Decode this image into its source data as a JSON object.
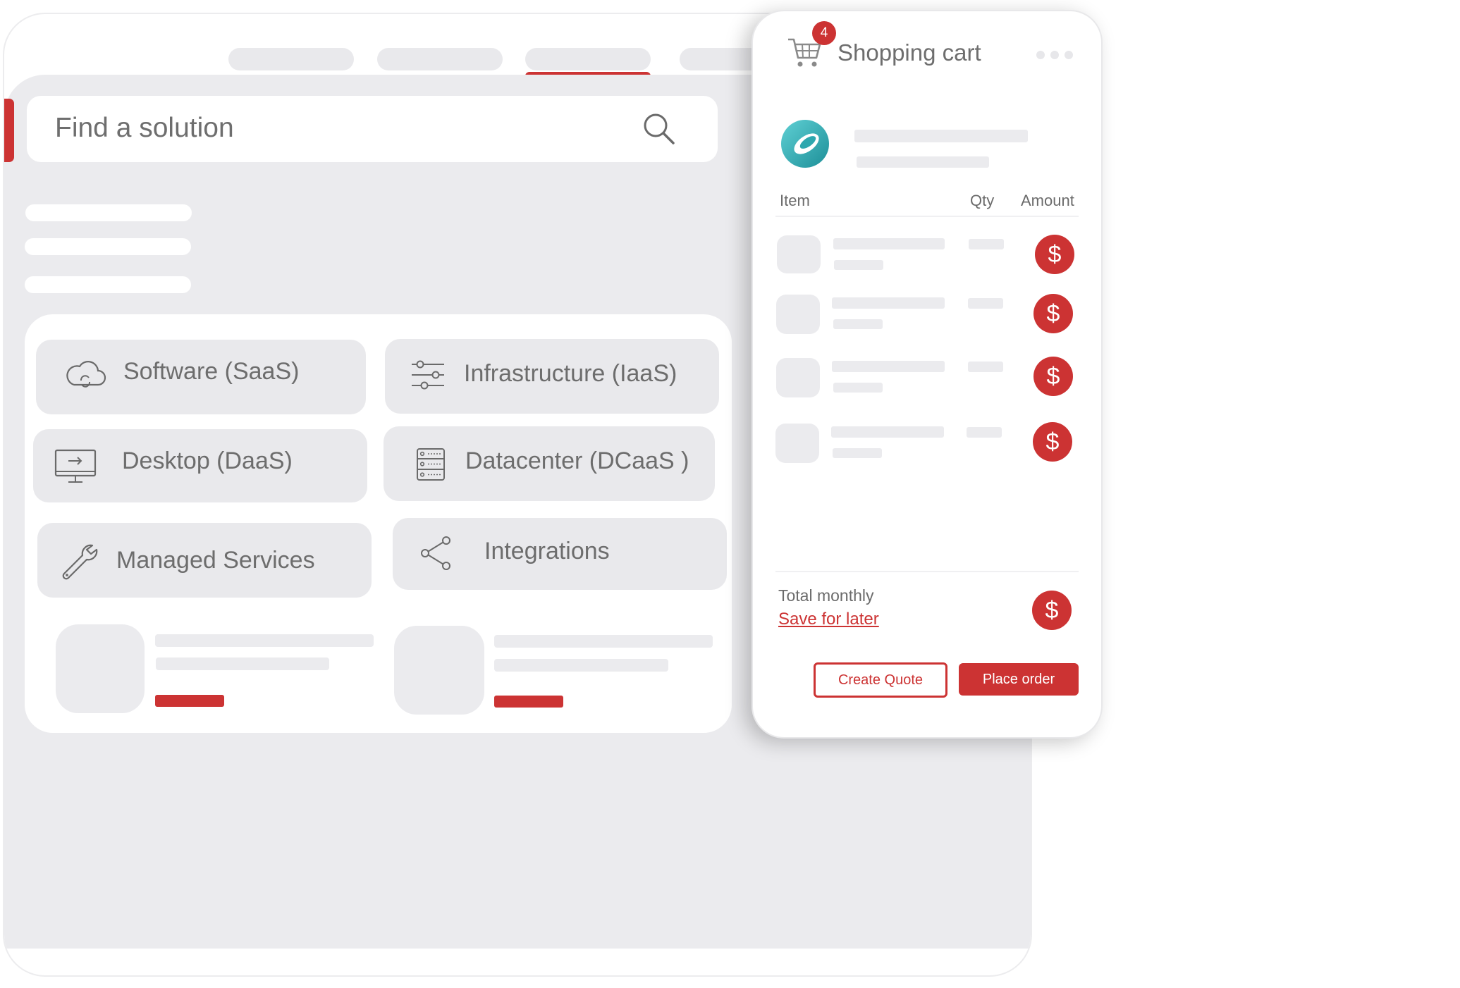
{
  "search": {
    "placeholder": "Find a solution"
  },
  "categories": [
    {
      "label": "Software (SaaS)",
      "icon": "cloud-sync-icon"
    },
    {
      "label": "Infrastructure (IaaS)",
      "icon": "sliders-icon"
    },
    {
      "label": "Desktop (DaaS)",
      "icon": "monitor-icon"
    },
    {
      "label": "Datacenter  (DCaaS )",
      "icon": "server-rack-icon"
    },
    {
      "label": "Managed Services",
      "icon": "wrench-icon"
    },
    {
      "label": "Integrations",
      "icon": "share-icon"
    }
  ],
  "cart": {
    "badge_count": "4",
    "title": "Shopping cart",
    "columns": {
      "item": "Item",
      "qty": "Qty",
      "amount": "Amount"
    },
    "amount_symbol": "$",
    "total_label": "Total monthly",
    "save_link": "Save for later",
    "create_quote_label": "Create Quote",
    "place_order_label": "Place order"
  },
  "colors": {
    "accent": "#cc3333",
    "placeholder_gray": "#ebebee",
    "vendor_logo": "#3fb8bf"
  }
}
